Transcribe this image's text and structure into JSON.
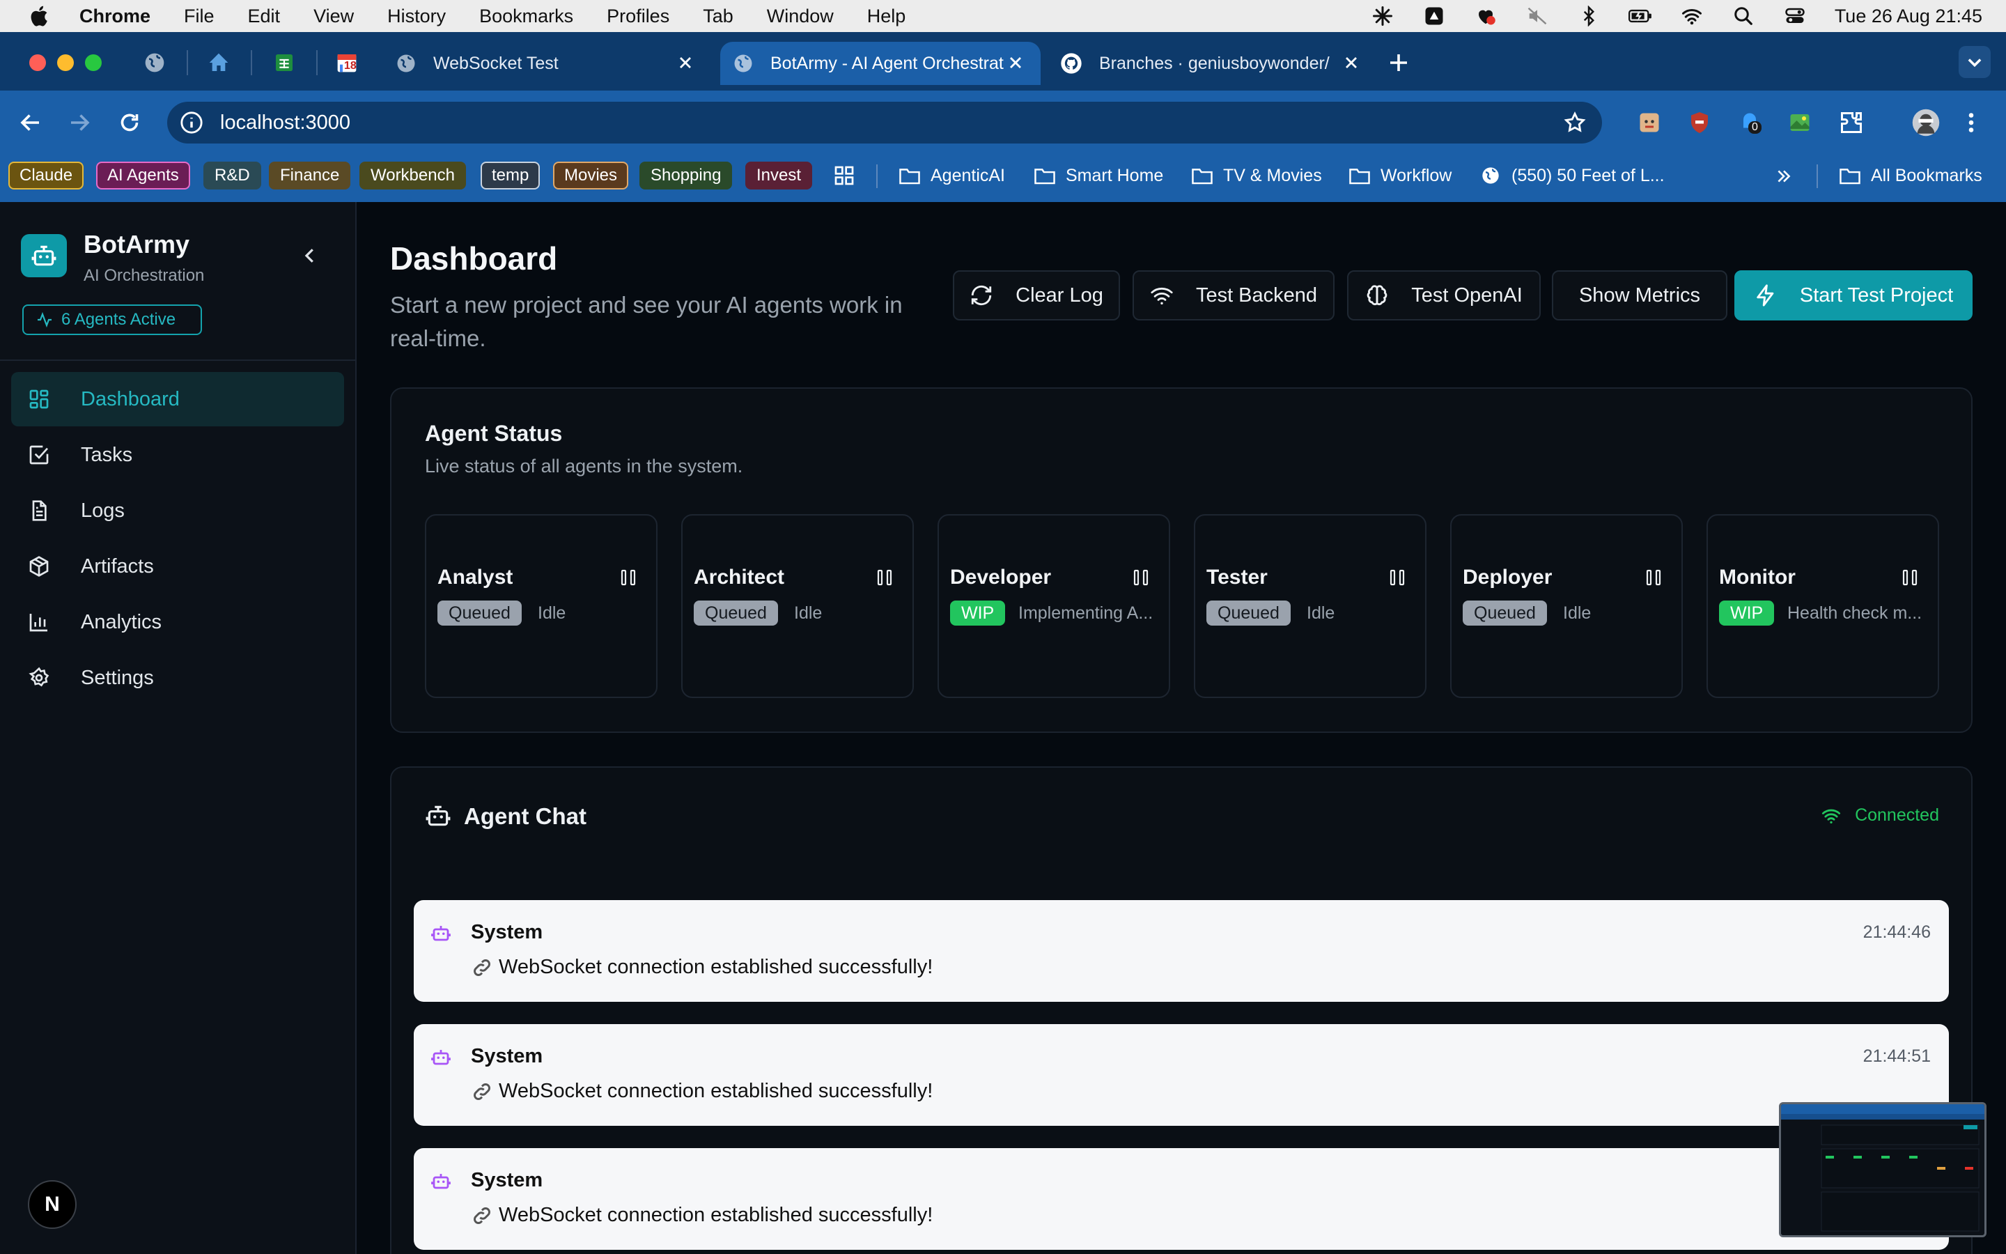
{
  "menubar": {
    "items": [
      "Chrome",
      "File",
      "Edit",
      "View",
      "History",
      "Bookmarks",
      "Profiles",
      "Tab",
      "Window",
      "Help"
    ],
    "clock": "Tue 26 Aug  21:45"
  },
  "browser": {
    "tabs": [
      {
        "title": "WebSocket Test"
      },
      {
        "title": "BotArmy - AI Agent Orchestration"
      },
      {
        "title": "Branches · geniusboywonder/"
      }
    ],
    "pinned_badge": "18",
    "url": "localhost:3000",
    "extension_badge": "0",
    "bookmark_chips": [
      {
        "label": "Claude",
        "color": "#6b5410",
        "border": "#e4b83a"
      },
      {
        "label": "AI Agents",
        "color": "#6b1d55",
        "border": "#e76bc8"
      },
      {
        "label": "R&D",
        "color": "#2a4a55"
      },
      {
        "label": "Finance",
        "color": "#5a4a25"
      },
      {
        "label": "Workbench",
        "color": "#4a4a1e"
      },
      {
        "label": "temp",
        "color": "#2d3a4a",
        "border": "#c9d3df"
      },
      {
        "label": "Movies",
        "color": "#5a3a1e",
        "border": "#e0a86a"
      },
      {
        "label": "Shopping",
        "color": "#2a4a2a"
      },
      {
        "label": "Invest",
        "color": "#5a2035"
      }
    ],
    "bookmarks": [
      "AgenticAI",
      "Smart Home",
      "TV & Movies",
      "Workflow",
      "(550) 50 Feet of L...",
      "All Bookmarks"
    ]
  },
  "sidebar": {
    "brand": "BotArmy",
    "subtitle": "AI Orchestration",
    "agents_active": "6 Agents Active",
    "nav": [
      {
        "label": "Dashboard",
        "icon": "dashboard-icon",
        "active": true
      },
      {
        "label": "Tasks",
        "icon": "checkbox-icon"
      },
      {
        "label": "Logs",
        "icon": "document-icon"
      },
      {
        "label": "Artifacts",
        "icon": "package-icon"
      },
      {
        "label": "Analytics",
        "icon": "bar-chart-icon"
      },
      {
        "label": "Settings",
        "icon": "gear-icon"
      }
    ],
    "footer_logo": "N"
  },
  "main": {
    "title": "Dashboard",
    "subtitle": "Start a new project and see your AI agents work in real-time.",
    "actions": {
      "clear_log": "Clear Log",
      "test_backend": "Test Backend",
      "test_openai": "Test OpenAI",
      "show_metrics": "Show Metrics",
      "start_project": "Start Test Project"
    },
    "agent_status": {
      "title": "Agent Status",
      "subtitle": "Live status of all agents in the system.",
      "agents": [
        {
          "name": "Analyst",
          "status": "Queued",
          "detail": "Idle"
        },
        {
          "name": "Architect",
          "status": "Queued",
          "detail": "Idle"
        },
        {
          "name": "Developer",
          "status": "WIP",
          "detail": "Implementing A..."
        },
        {
          "name": "Tester",
          "status": "Queued",
          "detail": "Idle"
        },
        {
          "name": "Deployer",
          "status": "Queued",
          "detail": "Idle"
        },
        {
          "name": "Monitor",
          "status": "WIP",
          "detail": "Health check m..."
        }
      ]
    },
    "chat": {
      "title": "Agent Chat",
      "connection": "Connected",
      "messages": [
        {
          "sender": "System",
          "time": "21:44:46",
          "text": "WebSocket connection established successfully!"
        },
        {
          "sender": "System",
          "time": "21:44:51",
          "text": "WebSocket connection established successfully!"
        },
        {
          "sender": "System",
          "time": "",
          "text": "WebSocket connection established successfully!"
        }
      ]
    }
  },
  "colors": {
    "accent": "#0e9aa7",
    "wip": "#22c55e",
    "queued": "#9aa2ad",
    "browser_frame": "#1b5fa8"
  }
}
